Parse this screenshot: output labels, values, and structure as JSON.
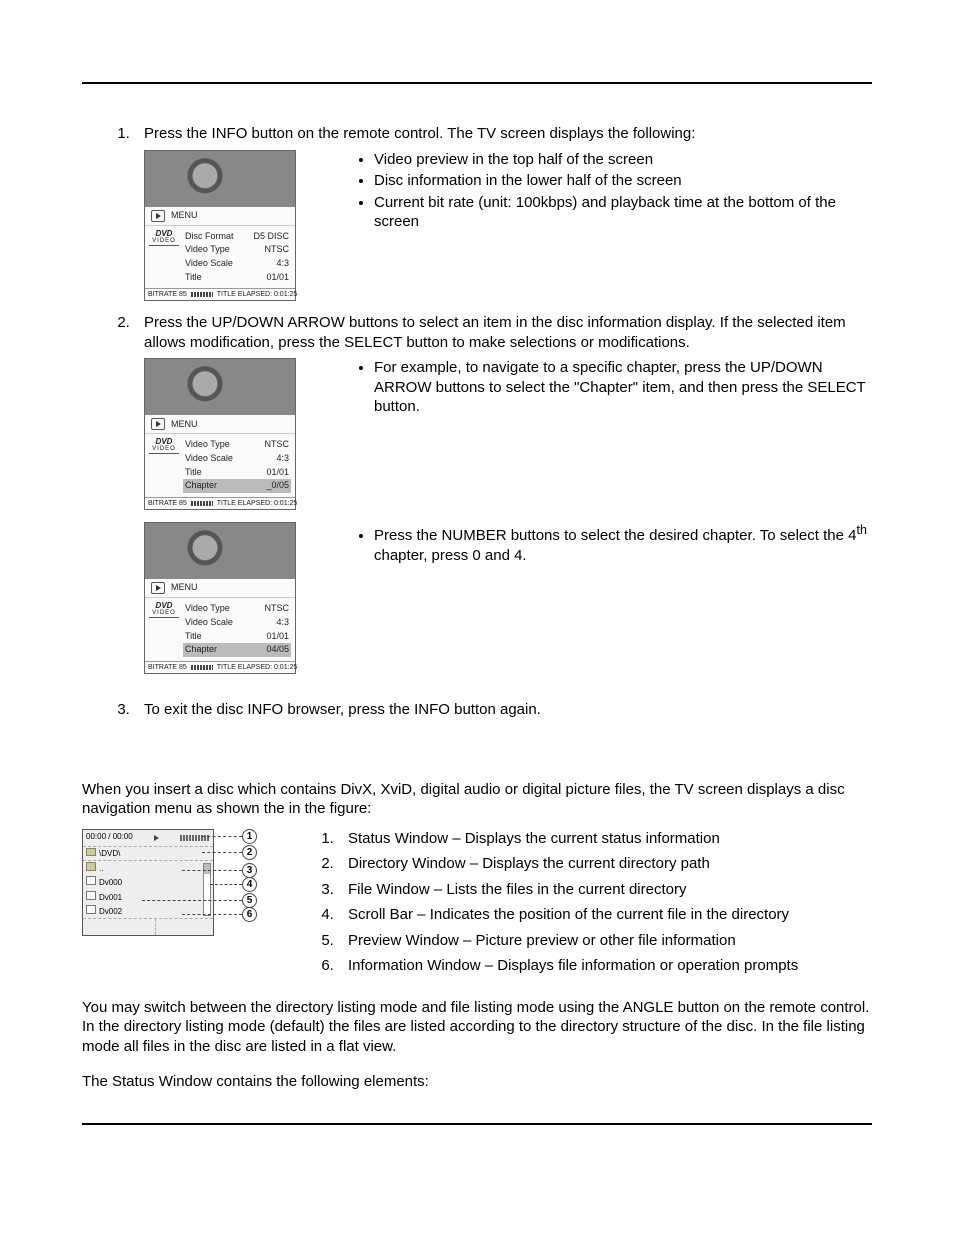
{
  "step1": {
    "text": "Press the INFO button on the remote control.  The TV screen displays the following:",
    "bullets": [
      "Video preview in the top half of the screen",
      "Disc information in the lower half of the screen",
      "Current bit rate (unit: 100kbps) and playback time at the bottom of the screen"
    ],
    "shot": {
      "menu": "MENU",
      "logo_top": "DVD",
      "logo_sub": "VIDEO",
      "rows": [
        {
          "k": "Disc Format",
          "v": "D5 DISC"
        },
        {
          "k": "Video Type",
          "v": "NTSC"
        },
        {
          "k": "Video Scale",
          "v": "4:3"
        },
        {
          "k": "Title",
          "v": "01/01"
        }
      ],
      "bar_l": "BITRATE  85",
      "bar_r": "TITLE ELAPSED: 0:01:25"
    }
  },
  "step2": {
    "text": "Press the UP/DOWN ARROW buttons to select an item in the disc information display.  If the selected item allows modification, press the SELECT button to make selections or modifications.",
    "sub1_bullet": "For example, to navigate to a specific chapter, press the UP/DOWN ARROW buttons to select the \"Chapter\" item, and then press the SELECT button.",
    "sub2_bullet_a": "Press the NUMBER buttons to select the desired chapter. To select the 4",
    "sub2_bullet_b": " chapter, press 0 and 4.",
    "sub2_sup": "th",
    "shot_a": {
      "menu": "MENU",
      "logo_top": "DVD",
      "logo_sub": "VIDEO",
      "rows": [
        {
          "k": "Video Type",
          "v": "NTSC"
        },
        {
          "k": "Video Scale",
          "v": "4:3"
        },
        {
          "k": "Title",
          "v": "01/01"
        },
        {
          "k": "Chapter",
          "v": "_0/05",
          "sel": true
        }
      ],
      "bar_l": "BITRATE  85",
      "bar_r": "TITLE ELAPSED: 0:01:25"
    },
    "shot_b": {
      "menu": "MENU",
      "logo_top": "DVD",
      "logo_sub": "VIDEO",
      "rows": [
        {
          "k": "Video Type",
          "v": "NTSC"
        },
        {
          "k": "Video Scale",
          "v": "4:3"
        },
        {
          "k": "Title",
          "v": "01/01"
        },
        {
          "k": "Chapter",
          "v": "04/05",
          "sel": true
        }
      ],
      "bar_l": "BITRATE  85",
      "bar_r": "TITLE ELAPSED: 0:01:25"
    }
  },
  "step3": {
    "text": "To exit the disc INFO browser, press the INFO button again."
  },
  "nav_intro": "When you insert a disc which contains DivX, XviD, digital audio or digital picture files, the TV screen displays a disc navigation menu as shown the in the figure:",
  "nav_items": [
    "Status Window – Displays the current status information",
    "Directory Window – Displays the current directory path",
    "File Window – Lists the files in the current directory",
    "Scroll Bar – Indicates the position of the current file in the directory",
    "Preview Window – Picture preview or other file information",
    "Information Window – Displays file information or operation prompts"
  ],
  "nav_shot": {
    "status_time": "00:00 / 00:00",
    "status_label": "ID/ALBUM",
    "dir": "\\DVD\\",
    "files": [
      "..",
      "Dv000",
      "Dv001",
      "Dv002"
    ],
    "callouts": [
      "1",
      "2",
      "3",
      "4",
      "5",
      "6"
    ]
  },
  "para_switch": "You may switch between the directory listing mode and file listing mode using the ANGLE button on the remote control.  In the directory listing mode (default) the files are listed according to the directory structure of the disc.  In the file listing mode all files in the disc are listed in a flat view.",
  "para_status": "The Status Window contains the following elements:"
}
